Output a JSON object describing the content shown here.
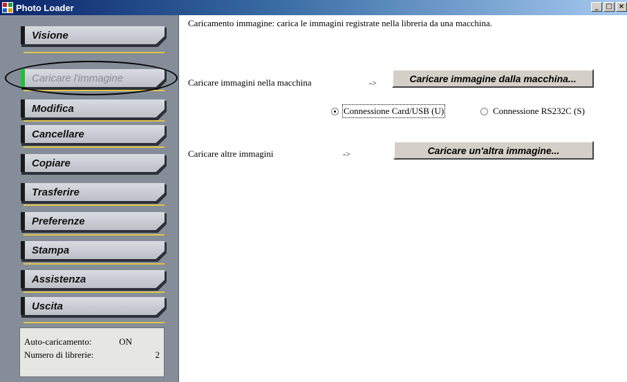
{
  "window": {
    "title": "Photo Loader",
    "controls": {
      "minimize": "_",
      "maximize": "□",
      "close": "×"
    }
  },
  "sidebar": {
    "items": [
      {
        "label": "Visione",
        "active": false
      },
      {
        "label": "Caricare l'immagine",
        "active": true
      },
      {
        "label": "Modifica",
        "active": false
      },
      {
        "label": "Cancellare",
        "active": false
      },
      {
        "label": "Copiare",
        "active": false
      },
      {
        "label": "Trasferire",
        "active": false
      },
      {
        "label": "Preferenze",
        "active": false
      },
      {
        "label": "Stampa",
        "active": false
      },
      {
        "label": "Assistenza",
        "active": false
      },
      {
        "label": "Uscita",
        "active": false
      }
    ],
    "status": {
      "auto_label": "Auto-caricamento:",
      "auto_value": "ON",
      "libraries_label": "Numero di librerie:",
      "libraries_value": "2"
    }
  },
  "main": {
    "description": "Caricamento immagine: carica le immagini registrate nella libreria da una macchina.",
    "load_camera": {
      "label": "Caricare immagini nella macchina",
      "arrow": "->",
      "button": "Caricare immagine dalla macchina..."
    },
    "connection": {
      "options": [
        {
          "label": "Connessione Card/USB (U)",
          "selected": true
        },
        {
          "label": "Connessione RS232C (S)",
          "selected": false
        }
      ]
    },
    "load_other": {
      "label": "Caricare altre immagini",
      "arrow": "->",
      "button": "Caricare un'altra immagine..."
    }
  },
  "colors": {
    "sidebar_bg": "#858d99",
    "active_marker": "#1fbf3a",
    "separator": "#e2c64a",
    "titlebar_start": "#0a246a"
  }
}
